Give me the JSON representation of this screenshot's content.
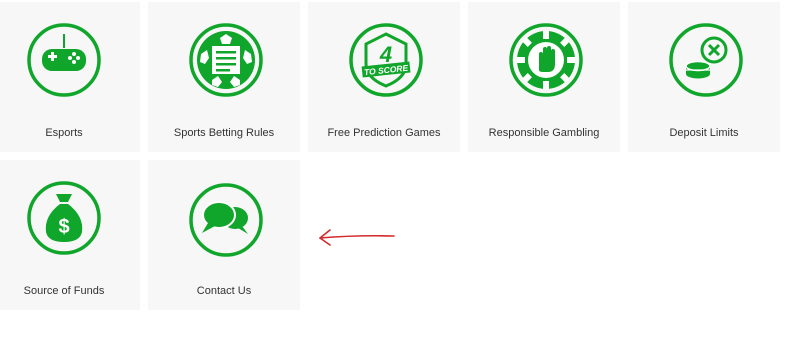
{
  "colors": {
    "accent_green": "#10a52b",
    "tile_bg": "#f7f7f7",
    "label_text": "#333333",
    "annotation_arrow": "#d42a2a"
  },
  "tiles": [
    {
      "label": "Esports",
      "icon": "gamepad-icon"
    },
    {
      "label": "Sports Betting Rules",
      "icon": "football-rules-icon"
    },
    {
      "label": "Free Prediction Games",
      "icon": "4-to-score-icon",
      "badge_number": "4",
      "badge_text": "TO SCORE"
    },
    {
      "label": "Responsible Gambling",
      "icon": "casino-chip-hand-icon"
    },
    {
      "label": "Deposit Limits",
      "icon": "coins-limit-icon"
    },
    {
      "label": "Source of Funds",
      "icon": "money-bag-icon",
      "badge_symbol": "$"
    },
    {
      "label": "Contact Us",
      "icon": "chat-bubbles-icon"
    }
  ],
  "annotation": {
    "icon": "arrow-left-icon"
  }
}
